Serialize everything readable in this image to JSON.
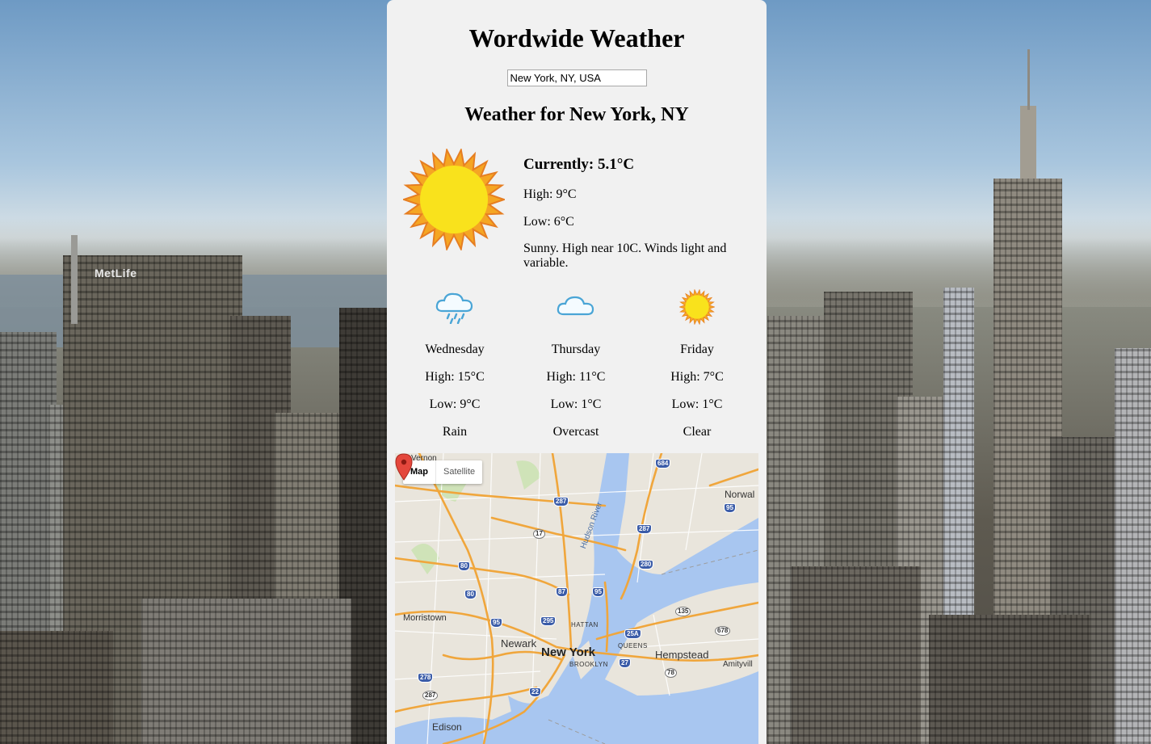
{
  "app": {
    "title": "Wordwide Weather"
  },
  "search": {
    "value": "New York, NY, USA"
  },
  "location": {
    "heading": "Weather for New York, NY"
  },
  "current": {
    "icon": "sun-icon",
    "temperature_label": "Currently: 5.1°C",
    "high_label": "High: 9°C",
    "low_label": "Low: 6°C",
    "description": "Sunny. High near 10C. Winds light and variable."
  },
  "forecast": [
    {
      "icon": "rain-cloud-icon",
      "day": "Wednesday",
      "high": "High: 15°C",
      "low": "Low: 9°C",
      "condition": "Rain"
    },
    {
      "icon": "cloud-icon",
      "day": "Thursday",
      "high": "High: 11°C",
      "low": "Low: 1°C",
      "condition": "Overcast"
    },
    {
      "icon": "sun-icon",
      "day": "Friday",
      "high": "High: 7°C",
      "low": "Low: 1°C",
      "condition": "Clear"
    }
  ],
  "map": {
    "toggle": {
      "map_label": "Map",
      "satellite_label": "Satellite",
      "active": "Map"
    },
    "places": {
      "new_york": "New York",
      "newark": "Newark",
      "morristown": "Morristown",
      "hempstead": "Hempstead",
      "edison": "Edison",
      "norwalk": "Norwal",
      "amityville": "Amityvill",
      "brooklyn": "BROOKLYN",
      "queens": "QUEENS",
      "manhattan": "HATTAN",
      "hudson_river": "Hudson River",
      "vernon": "Vernon"
    },
    "routes": [
      "684",
      "287",
      "95",
      "17",
      "287",
      "80",
      "80",
      "87",
      "95",
      "280",
      "95",
      "295",
      "25A",
      "135",
      "678",
      "27",
      "78",
      "278",
      "22",
      "287"
    ]
  },
  "background": {
    "building_sign": "MetLife"
  }
}
